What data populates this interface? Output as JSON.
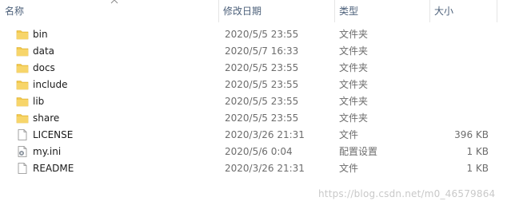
{
  "header": {
    "name_label": "名称",
    "date_label": "修改日期",
    "type_label": "类型",
    "size_label": "大小"
  },
  "files": [
    {
      "name": "bin",
      "date": "2020/5/5 23:55",
      "type": "文件夹",
      "size": "",
      "icon": "folder-icon"
    },
    {
      "name": "data",
      "date": "2020/5/7 16:33",
      "type": "文件夹",
      "size": "",
      "icon": "folder-icon"
    },
    {
      "name": "docs",
      "date": "2020/5/5 23:55",
      "type": "文件夹",
      "size": "",
      "icon": "folder-icon"
    },
    {
      "name": "include",
      "date": "2020/5/5 23:55",
      "type": "文件夹",
      "size": "",
      "icon": "folder-icon"
    },
    {
      "name": "lib",
      "date": "2020/5/5 23:55",
      "type": "文件夹",
      "size": "",
      "icon": "folder-icon"
    },
    {
      "name": "share",
      "date": "2020/5/5 23:55",
      "type": "文件夹",
      "size": "",
      "icon": "folder-icon"
    },
    {
      "name": "LICENSE",
      "date": "2020/3/26 21:31",
      "type": "文件",
      "size": "396 KB",
      "icon": "file-icon"
    },
    {
      "name": "my.ini",
      "date": "2020/5/6 0:04",
      "type": "配置设置",
      "size": "1 KB",
      "icon": "settings-file-icon"
    },
    {
      "name": "README",
      "date": "2020/3/26 21:31",
      "type": "文件",
      "size": "1 KB",
      "icon": "file-icon"
    }
  ],
  "watermark": "https://blog.csdn.net/m0_46579864",
  "colors": {
    "header_text": "#4c607a",
    "folder": "#f2c94c",
    "secondary_text": "#6d6d6d",
    "watermark": "#c9c9c9"
  }
}
